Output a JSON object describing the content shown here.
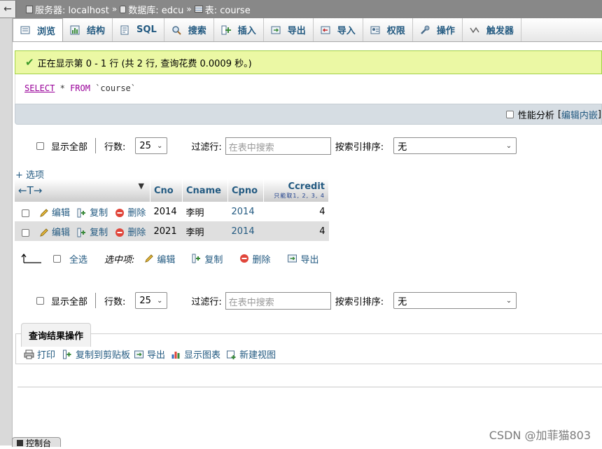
{
  "breadcrumb": {
    "server": "服务器: localhost",
    "database": "数据库: edcu",
    "table": "表: course",
    "separator": "»"
  },
  "tabs": [
    {
      "label": "浏览",
      "icon": "browse-icon"
    },
    {
      "label": "结构",
      "icon": "structure-icon"
    },
    {
      "label": "SQL",
      "icon": "sql-icon"
    },
    {
      "label": "搜索",
      "icon": "search-icon"
    },
    {
      "label": "插入",
      "icon": "insert-icon"
    },
    {
      "label": "导出",
      "icon": "export-icon"
    },
    {
      "label": "导入",
      "icon": "import-icon"
    },
    {
      "label": "权限",
      "icon": "privileges-icon"
    },
    {
      "label": "操作",
      "icon": "operations-icon"
    },
    {
      "label": "触发器",
      "icon": "triggers-icon"
    }
  ],
  "message": "正在显示第 0 - 1 行 (共 2 行, 查询花费 0.0009 秒。)",
  "sql": {
    "select": "SELECT",
    "star": "*",
    "from": "FROM",
    "table": "`course`"
  },
  "profiling": {
    "label": "性能分析",
    "bracket_open": "[",
    "edit_inline": "编辑内嵌",
    "bracket_close": "]"
  },
  "nav": {
    "show_all": "显示全部",
    "rows_label": "行数:",
    "rows_value": "25",
    "filter_label": "过滤行:",
    "filter_placeholder": "在表中搜索",
    "sort_label": "按索引排序:",
    "sort_value": "无"
  },
  "options_link": "+ 选项",
  "table": {
    "arrows": "←T→",
    "columns": [
      "Cno",
      "Cname",
      "Cpno",
      "Ccredit"
    ],
    "ccredit_note": "只能取1, 2, 3, 4",
    "row_actions": {
      "edit": "编辑",
      "copy": "复制",
      "delete": "删除"
    },
    "rows": [
      {
        "Cno": "2014",
        "Cname": "李明",
        "Cpno": "2014",
        "Ccredit": "4"
      },
      {
        "Cno": "2021",
        "Cname": "李明",
        "Cpno": "2014",
        "Ccredit": "4"
      }
    ]
  },
  "bulk": {
    "select_all": "全选",
    "with_selected": "选中项:",
    "edit": "编辑",
    "copy": "复制",
    "delete": "删除",
    "export": "导出"
  },
  "query_ops": {
    "title": "查询结果操作",
    "print": "打印",
    "copy_clipboard": "复制到剪贴板",
    "export": "导出",
    "show_chart": "显示图表",
    "create_view": "新建视图"
  },
  "console": "控制台",
  "watermark": "CSDN @加菲猫803",
  "colors": {
    "link": "#235a81",
    "success_bg": "#ebf8a4",
    "sql_keyword": "#990099"
  }
}
